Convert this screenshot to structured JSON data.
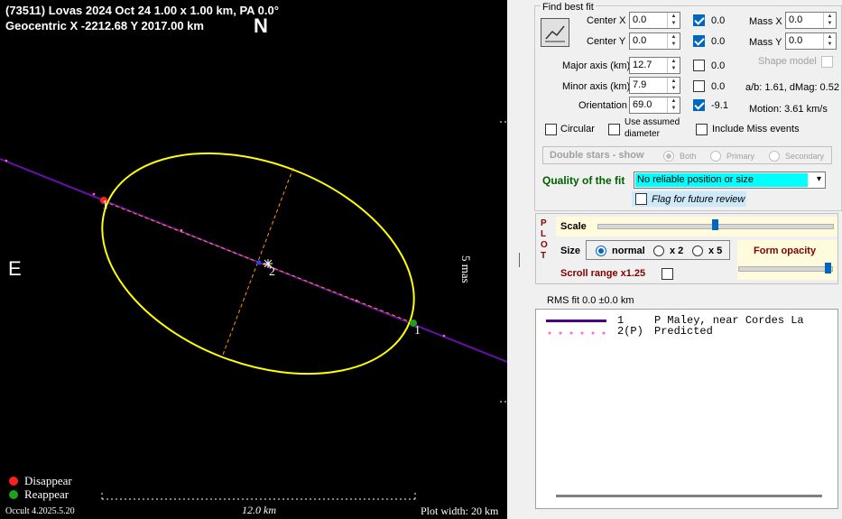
{
  "plot": {
    "title_line1": "(73511) Lovas  2024 Oct 24  1.00 x 1.00 km, PA 0.0°",
    "title_line2": "Geocentric X  -2212.68  Y 2017.00 km",
    "north_label": "N",
    "east_label": "E",
    "scale_label_vertical": "5 mas",
    "scale_bar_label": "12.0 km",
    "plot_width_label": "Plot width: 20 km",
    "version_label": "Occult 4.2025.5.20",
    "legend": {
      "disappear": "Disappear",
      "reappear": "Reappear",
      "disappear_color": "#ff2020",
      "reappear_color": "#20a020"
    },
    "chord_labels": {
      "first": "1",
      "second": "2",
      "third": "1"
    },
    "colors": {
      "ellipse": "#ffff00",
      "chord": "#6a0dad",
      "axes": "#ff9900"
    }
  },
  "panel": {
    "find_best_fit": "Find best fit",
    "center_x": {
      "label": "Center X",
      "value": "0.0",
      "fit": true,
      "fit_value": "0.0"
    },
    "center_y": {
      "label": "Center Y",
      "value": "0.0",
      "fit": true,
      "fit_value": "0.0"
    },
    "mass_x": {
      "label": "Mass X",
      "value": "0.0"
    },
    "mass_y": {
      "label": "Mass Y",
      "value": "0.0"
    },
    "major_axis": {
      "label": "Major axis (km)",
      "value": "12.7",
      "fit": false,
      "fit_value": "0.0"
    },
    "minor_axis": {
      "label": "Minor axis (km)",
      "value": "7.9",
      "fit": false,
      "fit_value": "0.0"
    },
    "orientation": {
      "label": "Orientation",
      "value": "69.0",
      "fit": true,
      "fit_value": "-9.1"
    },
    "shape_model": "Shape model",
    "ab_dmag": "a/b: 1.61, dMag: 0.52",
    "motion": "Motion: 3.61 km/s",
    "circular": "Circular",
    "use_assumed_diameter_1": "Use assumed",
    "use_assumed_diameter_2": "diameter",
    "include_miss": "Include Miss events",
    "double_stars": "Double stars - show",
    "both": "Both",
    "primary": "Primary",
    "secondary": "Secondary",
    "quality_label": "Quality of the fit",
    "quality_value": "No reliable position or size",
    "flag_review": "Flag for future review",
    "plot_letters": [
      "P",
      "L",
      "O",
      "T"
    ],
    "scale": "Scale",
    "size": "Size",
    "size_normal": "normal",
    "size_x2": "x 2",
    "size_x5": "x 5",
    "form_opacity": "Form opacity",
    "scroll_range": "Scroll range x1.25",
    "scale_level": 0.5,
    "opacity_level": 1.0,
    "rms_fit": "RMS fit 0.0 ±0.0 km",
    "chords": [
      {
        "num": "1",
        "name": "P Maley, near Cordes La"
      },
      {
        "num": "2(P)",
        "name": "Predicted"
      }
    ]
  }
}
